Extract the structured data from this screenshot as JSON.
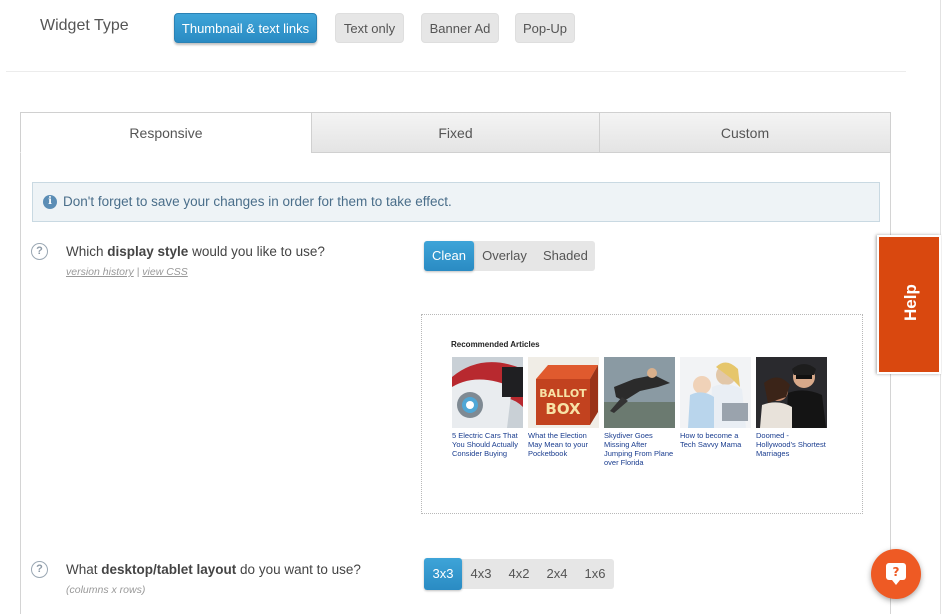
{
  "widget_type": {
    "label": "Widget Type",
    "options": [
      "Thumbnail & text links",
      "Text only",
      "Banner Ad",
      "Pop-Up"
    ],
    "selected": "Thumbnail & text links"
  },
  "tabs": [
    "Responsive",
    "Fixed",
    "Custom"
  ],
  "active_tab": "Responsive",
  "info_message": "Don't forget to save your changes in order for them to take effect.",
  "display_style": {
    "question_pre": "Which ",
    "question_bold": "display style",
    "question_post": " would you like to use?",
    "link_version_history": "version history",
    "link_separator": "|",
    "link_view_css": "view CSS",
    "options": [
      "Clean",
      "Overlay",
      "Shaded"
    ],
    "selected": "Clean"
  },
  "preview": {
    "title": "Recommended Articles",
    "articles": [
      {
        "caption": "5 Electric Cars That You Should Actually Consider Buying",
        "image": "electric-car-thumbnail"
      },
      {
        "caption": "What the Election May Mean to your Pocketbook",
        "image": "ballot-box-thumbnail",
        "image_text": [
          "BALLOT",
          "BOX"
        ]
      },
      {
        "caption": "Skydiver Goes Missing After Jumping From Plane over Florida",
        "image": "skydiver-thumbnail"
      },
      {
        "caption": "How to become a Tech Savvy Mama",
        "image": "mother-baby-laptop-thumbnail"
      },
      {
        "caption": "Doomed - Hollywood's Shortest Marriages",
        "image": "celebrity-couple-thumbnail"
      }
    ]
  },
  "layout": {
    "question_pre": "What ",
    "question_bold": "desktop/tablet layout",
    "question_post": " do you want to use?",
    "sub": "(columns x rows)",
    "options": [
      "3x3",
      "4x3",
      "4x2",
      "2x4",
      "1x6"
    ],
    "selected": "3x3"
  },
  "help": {
    "label": "Help"
  },
  "icons": {
    "info": "i",
    "question": "?",
    "chat": "?"
  },
  "colors": {
    "accent_blue": "#2a8bc3",
    "help_orange": "#d9480f",
    "chat_orange": "#ee5a24",
    "caption_link": "#1a3d8f"
  }
}
